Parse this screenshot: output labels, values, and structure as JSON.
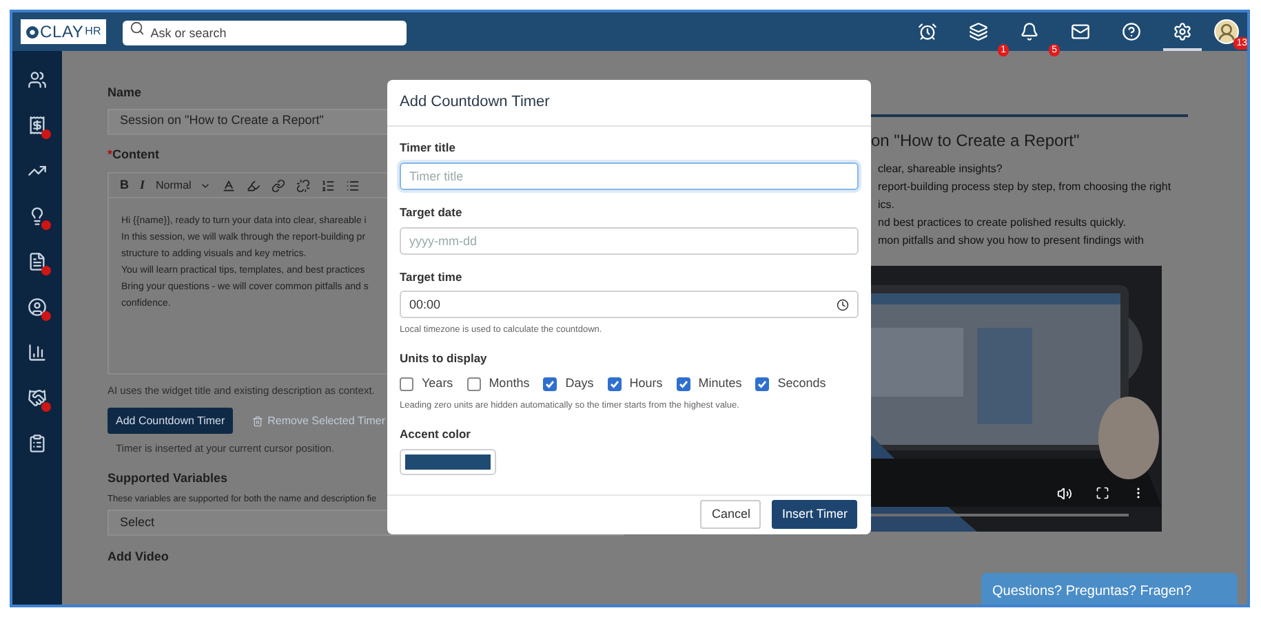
{
  "topbar": {
    "logo": {
      "primary": "CLAY",
      "secondary": "HR"
    },
    "search": {
      "placeholder": "Ask or search"
    },
    "icons": [
      {
        "kind": "alarm"
      },
      {
        "kind": "layers",
        "badge": "1"
      },
      {
        "kind": "bell",
        "badge": "5"
      },
      {
        "kind": "mail"
      },
      {
        "kind": "help"
      },
      {
        "kind": "settings",
        "selected": true
      },
      {
        "kind": "avatar",
        "badge": "13"
      }
    ]
  },
  "sidebar": {
    "items": [
      {
        "kind": "users",
        "alert": false
      },
      {
        "kind": "receipt",
        "alert": true
      },
      {
        "kind": "trend",
        "alert": false
      },
      {
        "kind": "idea",
        "alert": true
      },
      {
        "kind": "document",
        "alert": true
      },
      {
        "kind": "person",
        "alert": true
      },
      {
        "kind": "chart",
        "alert": false
      },
      {
        "kind": "team",
        "alert": true
      },
      {
        "kind": "clipboard",
        "alert": false
      }
    ]
  },
  "form": {
    "name": {
      "label": "Name",
      "value": "Session on \"How to Create a Report\""
    },
    "content": {
      "label": "Content",
      "required_mark": "*",
      "toolbar": {
        "bold": "B",
        "italic": "I",
        "style": "Normal"
      },
      "lines": [
        "Hi {{name}}, ready to turn your data into clear, shareable i",
        "In this session, we will walk through the report-building pr",
        "structure to adding visuals and key metrics.",
        "You will learn practical tips, templates, and best practices",
        "Bring your questions - we will cover common pitfalls and s",
        "confidence."
      ]
    },
    "ai_note": "AI uses the widget title and existing description as context.",
    "buttons": [
      {
        "label": "Add Countdown Timer",
        "disabled": false
      },
      {
        "label": "Remove Selected Timer",
        "disabled": true
      }
    ],
    "timer_note": "Timer is inserted at your current cursor position.",
    "variables": {
      "label": "Supported Variables",
      "hint": "These variables are supported for both the name and description fie",
      "select": "Select"
    },
    "video_label": "Add Video"
  },
  "preview": {
    "title": "on \"How to Create a Report\"",
    "lines": [
      "clear, shareable insights?",
      "report-building process step by step, from choosing the right",
      "ics.",
      "nd best practices to create polished results quickly.",
      "mon pitfalls and show you how to present findings with"
    ],
    "video": {
      "kind": "picture"
    }
  },
  "dialog": {
    "title": "Add Countdown Timer",
    "timer_title": {
      "label": "Timer title",
      "placeholder": "Timer title",
      "focused": true
    },
    "target_date": {
      "label": "Target date",
      "placeholder": "yyyy-mm-dd"
    },
    "target_time": {
      "label": "Target time",
      "value": "00:00",
      "hint": "Local timezone is used to calculate the countdown."
    },
    "units": {
      "label": "Units to display",
      "items": [
        {
          "label": "Years",
          "checked": false
        },
        {
          "label": "Months",
          "checked": false
        },
        {
          "label": "Days",
          "checked": true
        },
        {
          "label": "Hours",
          "checked": true
        },
        {
          "label": "Minutes",
          "checked": true
        },
        {
          "label": "Seconds",
          "checked": true
        }
      ],
      "hint": "Leading zero units are hidden automatically so the timer starts from the highest value."
    },
    "accent": {
      "label": "Accent color",
      "color": "#1f4b73"
    },
    "buttons": [
      {
        "label": "Cancel",
        "kind": "secondary"
      },
      {
        "label": "Insert Timer",
        "kind": "primary"
      }
    ]
  },
  "chat": {
    "label": "Questions? Preguntas? Fragen?"
  }
}
